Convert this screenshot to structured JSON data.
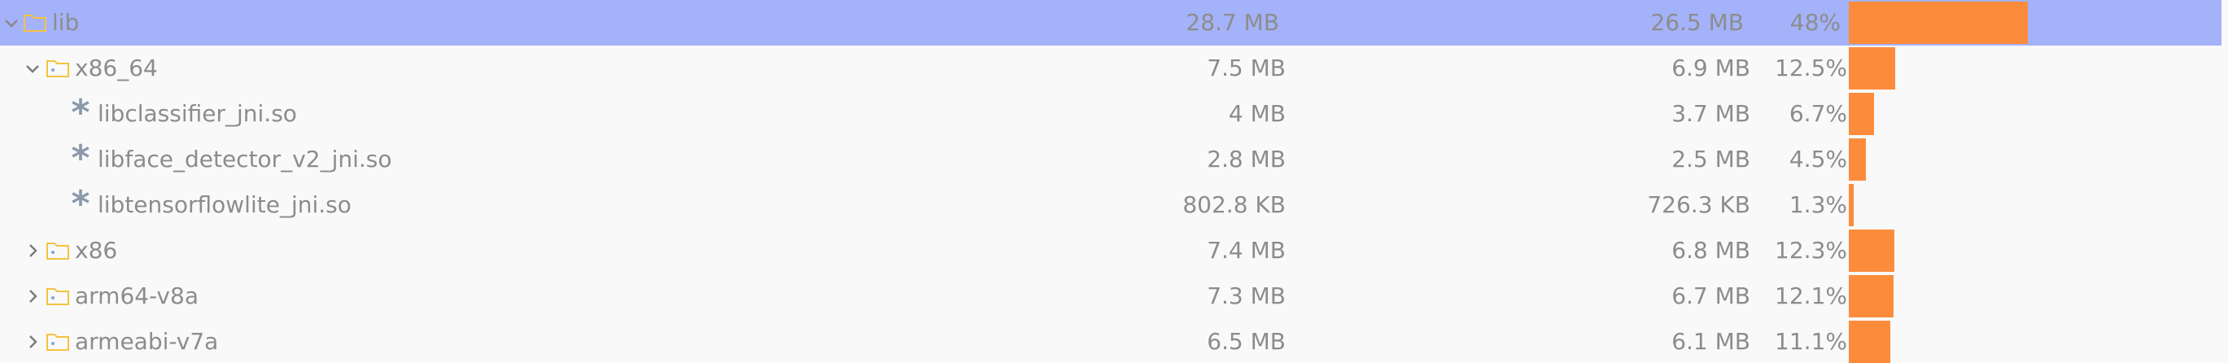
{
  "colors": {
    "selected_row_bg": "#a4b2f9",
    "bar_fill": "#fc8c3c",
    "folder_icon": "#f5c242",
    "file_icon": "#8a9aaa",
    "text": "#8c8c8c",
    "background": "#f9f9f9"
  },
  "rows": [
    {
      "name": "lib",
      "size": "28.7 MB",
      "download_size": "26.5 MB",
      "percent": "48%",
      "percent_value": 48,
      "icon": "folder-icon",
      "toggle": "chevron-down-icon",
      "selected": true
    },
    {
      "name": "x86_64",
      "size": "7.5 MB",
      "download_size": "6.9 MB",
      "percent": "12.5%",
      "percent_value": 12.5,
      "icon": "folder-icon",
      "toggle": "chevron-down-icon",
      "selected": false
    },
    {
      "name": "libclassifier_jni.so",
      "size": "4 MB",
      "download_size": "3.7 MB",
      "percent": "6.7%",
      "percent_value": 6.7,
      "icon": "asterisk-icon",
      "toggle": "",
      "selected": false
    },
    {
      "name": "libface_detector_v2_jni.so",
      "size": "2.8 MB",
      "download_size": "2.5 MB",
      "percent": "4.5%",
      "percent_value": 4.5,
      "icon": "asterisk-icon",
      "toggle": "",
      "selected": false
    },
    {
      "name": "libtensorflowlite_jni.so",
      "size": "802.8 KB",
      "download_size": "726.3 KB",
      "percent": "1.3%",
      "percent_value": 1.3,
      "icon": "asterisk-icon",
      "toggle": "",
      "selected": false
    },
    {
      "name": "x86",
      "size": "7.4 MB",
      "download_size": "6.8 MB",
      "percent": "12.3%",
      "percent_value": 12.3,
      "icon": "folder-icon",
      "toggle": "chevron-right-icon",
      "selected": false
    },
    {
      "name": "arm64-v8a",
      "size": "7.3 MB",
      "download_size": "6.7 MB",
      "percent": "12.1%",
      "percent_value": 12.1,
      "icon": "folder-icon",
      "toggle": "chevron-right-icon",
      "selected": false
    },
    {
      "name": "armeabi-v7a",
      "size": "6.5 MB",
      "download_size": "6.1 MB",
      "percent": "11.1%",
      "percent_value": 11.1,
      "icon": "folder-icon",
      "toggle": "chevron-right-icon",
      "selected": false
    }
  ]
}
